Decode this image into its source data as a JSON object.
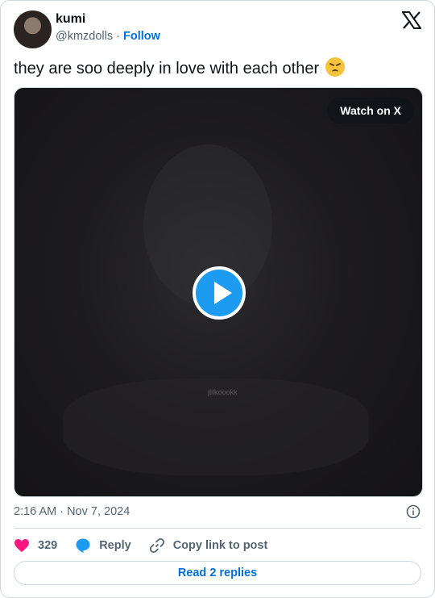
{
  "author": {
    "name": "kumi",
    "handle": "@kmzdolls",
    "separator": " · ",
    "follow_label": "Follow"
  },
  "tweet": {
    "text": "they are soo deeply in love with each other",
    "emoji_icon": "confounded-face-icon"
  },
  "media": {
    "watch_label": "Watch on X",
    "watermark": "jlilkoookk",
    "play_icon": "play-icon"
  },
  "meta": {
    "timestamp": "2:16 AM · Nov 7, 2024"
  },
  "actions": {
    "like_count": "329",
    "reply_label": "Reply",
    "copy_label": "Copy link to post"
  },
  "read_replies_label": "Read 2 replies",
  "colors": {
    "like": "#f91880",
    "reply": "#1d9bf0",
    "link": "#006fd6",
    "play": "#1d9bf0"
  }
}
